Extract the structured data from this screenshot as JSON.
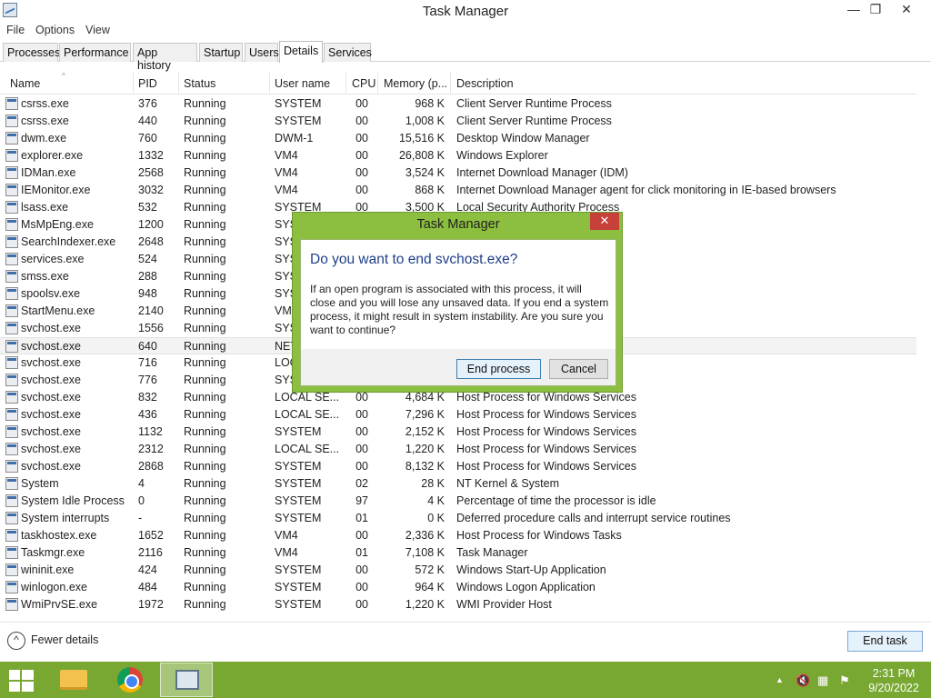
{
  "window": {
    "title": "Task Manager",
    "min": "—",
    "max": "❐",
    "close": "✕"
  },
  "menu": [
    "File",
    "Options",
    "View"
  ],
  "tabs": [
    {
      "label": "Processes",
      "active": false
    },
    {
      "label": "Performance",
      "active": false
    },
    {
      "label": "App history",
      "active": false
    },
    {
      "label": "Startup",
      "active": false
    },
    {
      "label": "Users",
      "active": false
    },
    {
      "label": "Details",
      "active": true
    },
    {
      "label": "Services",
      "active": false
    }
  ],
  "columns": [
    "Name",
    "PID",
    "Status",
    "User name",
    "CPU",
    "Memory (p...",
    "Description"
  ],
  "sort_glyph": "^",
  "rows": [
    {
      "name": "csrss.exe",
      "pid": "376",
      "status": "Running",
      "user": "SYSTEM",
      "cpu": "00",
      "mem": "968 K",
      "desc": "Client Server Runtime Process"
    },
    {
      "name": "csrss.exe",
      "pid": "440",
      "status": "Running",
      "user": "SYSTEM",
      "cpu": "00",
      "mem": "1,008 K",
      "desc": "Client Server Runtime Process"
    },
    {
      "name": "dwm.exe",
      "pid": "760",
      "status": "Running",
      "user": "DWM-1",
      "cpu": "00",
      "mem": "15,516 K",
      "desc": "Desktop Window Manager"
    },
    {
      "name": "explorer.exe",
      "pid": "1332",
      "status": "Running",
      "user": "VM4",
      "cpu": "00",
      "mem": "26,808 K",
      "desc": "Windows Explorer"
    },
    {
      "name": "IDMan.exe",
      "pid": "2568",
      "status": "Running",
      "user": "VM4",
      "cpu": "00",
      "mem": "3,524 K",
      "desc": "Internet Download Manager (IDM)"
    },
    {
      "name": "IEMonitor.exe",
      "pid": "3032",
      "status": "Running",
      "user": "VM4",
      "cpu": "00",
      "mem": "868 K",
      "desc": "Internet Download Manager agent for click monitoring in IE-based browsers"
    },
    {
      "name": "lsass.exe",
      "pid": "532",
      "status": "Running",
      "user": "SYSTEM",
      "cpu": "00",
      "mem": "3,500 K",
      "desc": "Local Security Authority Process"
    },
    {
      "name": "MsMpEng.exe",
      "pid": "1200",
      "status": "Running",
      "user": "SYS",
      "cpu": "",
      "mem": "",
      "desc": ""
    },
    {
      "name": "SearchIndexer.exe",
      "pid": "2648",
      "status": "Running",
      "user": "SYS",
      "cpu": "",
      "mem": "",
      "desc": ""
    },
    {
      "name": "services.exe",
      "pid": "524",
      "status": "Running",
      "user": "SYS",
      "cpu": "",
      "mem": "",
      "desc": ""
    },
    {
      "name": "smss.exe",
      "pid": "288",
      "status": "Running",
      "user": "SYS",
      "cpu": "",
      "mem": "",
      "desc": ""
    },
    {
      "name": "spoolsv.exe",
      "pid": "948",
      "status": "Running",
      "user": "SYS",
      "cpu": "",
      "mem": "",
      "desc": ""
    },
    {
      "name": "StartMenu.exe",
      "pid": "2140",
      "status": "Running",
      "user": "VM",
      "cpu": "",
      "mem": "",
      "desc": ""
    },
    {
      "name": "svchost.exe",
      "pid": "1556",
      "status": "Running",
      "user": "SYS",
      "cpu": "",
      "mem": "",
      "desc": ""
    },
    {
      "name": "svchost.exe",
      "pid": "640",
      "status": "Running",
      "user": "NET",
      "cpu": "",
      "mem": "",
      "desc": "",
      "selected": true
    },
    {
      "name": "svchost.exe",
      "pid": "716",
      "status": "Running",
      "user": "LOC",
      "cpu": "",
      "mem": "",
      "desc": ""
    },
    {
      "name": "svchost.exe",
      "pid": "776",
      "status": "Running",
      "user": "SYS",
      "cpu": "",
      "mem": "",
      "desc": ""
    },
    {
      "name": "svchost.exe",
      "pid": "832",
      "status": "Running",
      "user": "LOCAL SE...",
      "cpu": "00",
      "mem": "4,684 K",
      "desc": "Host Process for Windows Services"
    },
    {
      "name": "svchost.exe",
      "pid": "436",
      "status": "Running",
      "user": "LOCAL SE...",
      "cpu": "00",
      "mem": "7,296 K",
      "desc": "Host Process for Windows Services"
    },
    {
      "name": "svchost.exe",
      "pid": "1132",
      "status": "Running",
      "user": "SYSTEM",
      "cpu": "00",
      "mem": "2,152 K",
      "desc": "Host Process for Windows Services"
    },
    {
      "name": "svchost.exe",
      "pid": "2312",
      "status": "Running",
      "user": "LOCAL SE...",
      "cpu": "00",
      "mem": "1,220 K",
      "desc": "Host Process for Windows Services"
    },
    {
      "name": "svchost.exe",
      "pid": "2868",
      "status": "Running",
      "user": "SYSTEM",
      "cpu": "00",
      "mem": "8,132 K",
      "desc": "Host Process for Windows Services"
    },
    {
      "name": "System",
      "pid": "4",
      "status": "Running",
      "user": "SYSTEM",
      "cpu": "02",
      "mem": "28 K",
      "desc": "NT Kernel & System"
    },
    {
      "name": "System Idle Process",
      "pid": "0",
      "status": "Running",
      "user": "SYSTEM",
      "cpu": "97",
      "mem": "4 K",
      "desc": "Percentage of time the processor is idle"
    },
    {
      "name": "System interrupts",
      "pid": "-",
      "status": "Running",
      "user": "SYSTEM",
      "cpu": "01",
      "mem": "0 K",
      "desc": "Deferred procedure calls and interrupt service routines"
    },
    {
      "name": "taskhostex.exe",
      "pid": "1652",
      "status": "Running",
      "user": "VM4",
      "cpu": "00",
      "mem": "2,336 K",
      "desc": "Host Process for Windows Tasks"
    },
    {
      "name": "Taskmgr.exe",
      "pid": "2116",
      "status": "Running",
      "user": "VM4",
      "cpu": "01",
      "mem": "7,108 K",
      "desc": "Task Manager"
    },
    {
      "name": "wininit.exe",
      "pid": "424",
      "status": "Running",
      "user": "SYSTEM",
      "cpu": "00",
      "mem": "572 K",
      "desc": "Windows Start-Up Application"
    },
    {
      "name": "winlogon.exe",
      "pid": "484",
      "status": "Running",
      "user": "SYSTEM",
      "cpu": "00",
      "mem": "964 K",
      "desc": "Windows Logon Application"
    },
    {
      "name": "WmiPrvSE.exe",
      "pid": "1972",
      "status": "Running",
      "user": "SYSTEM",
      "cpu": "00",
      "mem": "1,220 K",
      "desc": "WMI Provider Host"
    }
  ],
  "footer": {
    "fewer_icon": "^",
    "fewer_label": "Fewer details",
    "end_task": "End task"
  },
  "dialog": {
    "title": "Task Manager",
    "close": "✕",
    "heading": "Do you want to end svchost.exe?",
    "message": "If an open program is associated with this process, it will close and you will lose any unsaved data. If you end a system process, it might result in system instability. Are you sure you want to continue?",
    "primary": "End process",
    "secondary": "Cancel"
  },
  "taskbar": {
    "tray_up": "▲",
    "time": "2:31 PM",
    "date": "9/20/2022",
    "accent": "#78a832"
  }
}
